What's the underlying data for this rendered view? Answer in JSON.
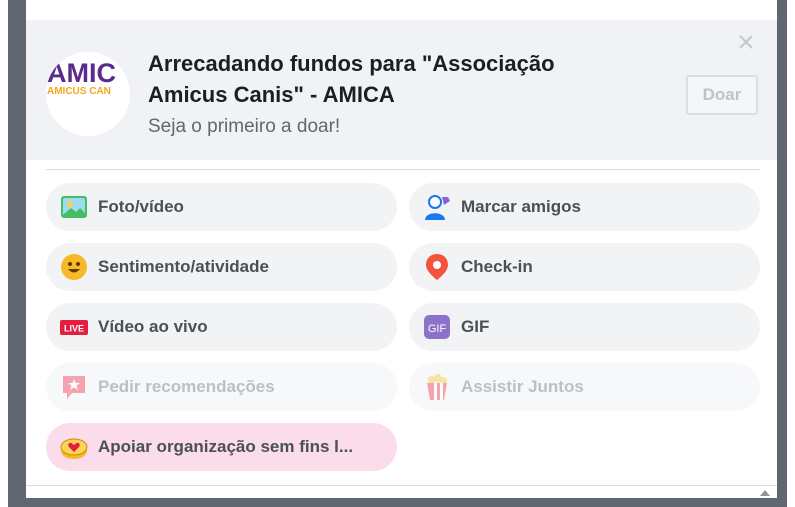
{
  "fundraiser": {
    "title": "Arrecadando fundos para \"Associação Amicus Canis\" - AMICA",
    "subtitle": "Seja o primeiro a doar!",
    "donate_label": "Doar",
    "logo_text_top": "AMIC",
    "logo_text_bottom": "AMICUS CAN"
  },
  "options": [
    {
      "label": "Foto/vídeo",
      "icon": "photo-video-icon"
    },
    {
      "label": "Marcar amigos",
      "icon": "tag-friends-icon"
    },
    {
      "label": "Sentimento/atividade",
      "icon": "feeling-emoji-icon"
    },
    {
      "label": "Check-in",
      "icon": "location-pin-icon"
    },
    {
      "label": "Vídeo ao vivo",
      "icon": "live-video-icon",
      "badge": "LIVE"
    },
    {
      "label": "GIF",
      "icon": "gif-icon",
      "badge": "GIF"
    },
    {
      "label": "Pedir recomendações",
      "icon": "recommendation-icon",
      "state": "disabled"
    },
    {
      "label": "Assistir Juntos",
      "icon": "watch-party-popcorn-icon",
      "state": "disabled"
    },
    {
      "label": "Apoiar organização sem fins l...",
      "icon": "nonprofit-heart-icon",
      "state": "highlighted"
    }
  ],
  "colors": {
    "header_bg": "#f0f2f5",
    "frame": "#606770",
    "highlight": "#fadcea",
    "text": "#4b4f56"
  }
}
